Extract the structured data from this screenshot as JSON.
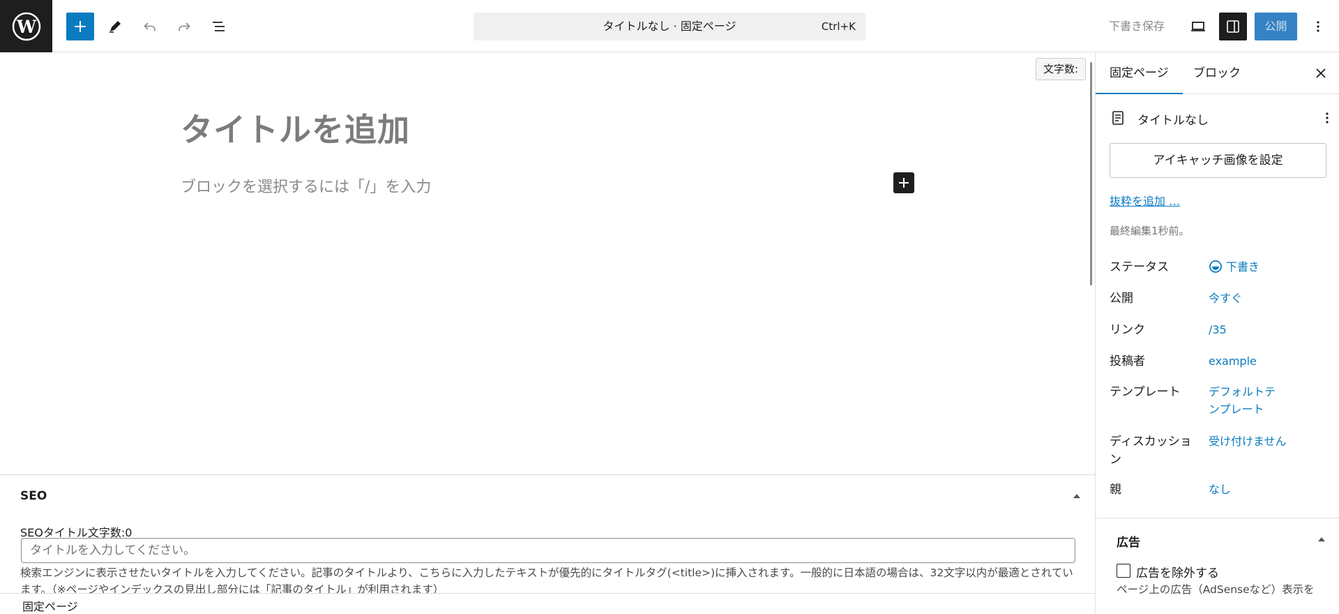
{
  "toolbar": {
    "command_title": "タイトルなし · 固定ページ",
    "command_shortcut": "Ctrl+K",
    "save_draft": "下書き保存",
    "publish": "公開"
  },
  "editor": {
    "word_count": "文字数:",
    "title_placeholder": "タイトルを追加",
    "block_placeholder": "ブロックを選択するには「/」を入力"
  },
  "seo": {
    "heading": "SEO",
    "title_label": "SEOタイトル文字数:0",
    "title_placeholder": "タイトルを入力してください。",
    "help": "検索エンジンに表示させたいタイトルを入力してください。記事のタイトルより、こちらに入力したテキストが優先的にタイトルタグ(<title>)に挿入されます。一般的に日本語の場合は、32文字以内が最適とされています。（※ページやインデックスの見出し部分には「記事のタイトル」が利用されます）"
  },
  "footer": {
    "breadcrumb": "固定ページ"
  },
  "sidebar": {
    "tabs": [
      "固定ページ",
      "ブロック"
    ],
    "doc_title": "タイトルなし",
    "featured_image_button": "アイキャッチ画像を設定",
    "excerpt_link": "抜粋を追加 …",
    "last_edited": "最終編集1秒前。",
    "meta": [
      {
        "label": "ステータス",
        "value": "下書き"
      },
      {
        "label": "公開",
        "value": "今すぐ"
      },
      {
        "label": "リンク",
        "value": "/35"
      },
      {
        "label": "投稿者",
        "value": "example"
      },
      {
        "label": "テンプレート",
        "value": "デフォルトテンプレート"
      },
      {
        "label": "ディスカッション",
        "value": "受け付けません"
      },
      {
        "label": "親",
        "value": "なし"
      }
    ],
    "ads": {
      "heading": "広告",
      "checkbox_label": "広告を除外する",
      "description": "ページ上の広告（AdSenseなど）表示を"
    }
  },
  "colors": {
    "accent": "#0a7bc1",
    "publish_bg": "#3582c4",
    "dark": "#1e1e1e"
  }
}
